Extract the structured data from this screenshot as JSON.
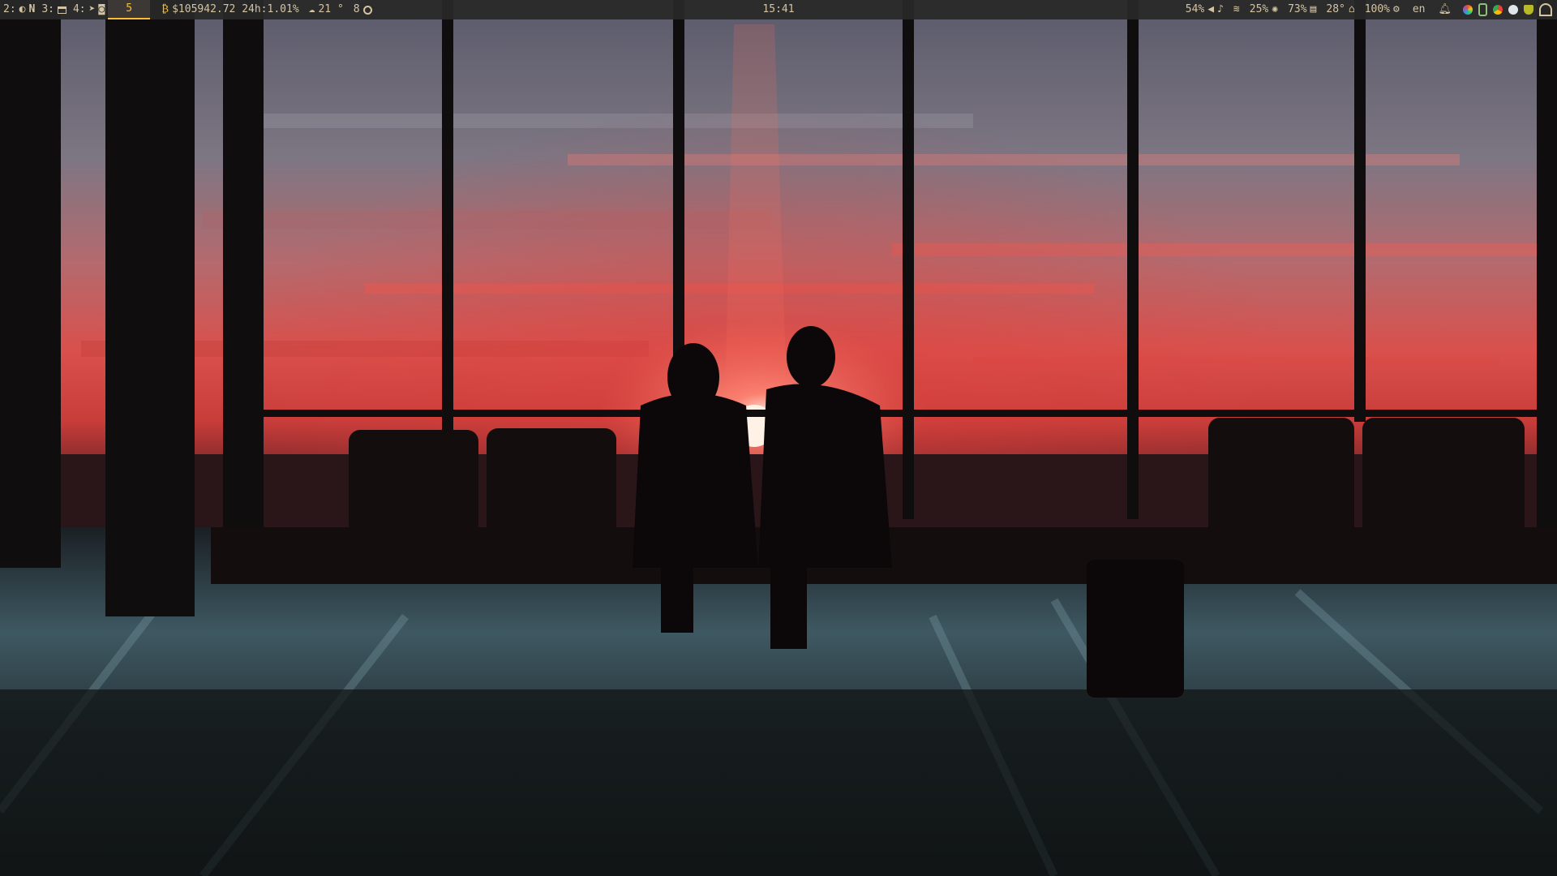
{
  "workspaces": [
    {
      "label": "2:"
    },
    {
      "label": "3:"
    },
    {
      "label": "4:"
    },
    {
      "label": "5",
      "active": true
    }
  ],
  "crypto": {
    "symbol": "₿",
    "text": "$105942.72 24h:1.01%"
  },
  "weather": {
    "temp": "21 °"
  },
  "updates": {
    "count": "8"
  },
  "clock": "15:41",
  "status": {
    "brightness": "54%",
    "volume_icon": "speaker-icon",
    "mic_icon": "microphone-icon",
    "wifi_icon": "wifi-icon",
    "cpu": "25%",
    "memory": "73%",
    "temperature": "28°",
    "battery": "100%",
    "keyboard_layout": "en"
  },
  "colors": {
    "bar_bg": "#282828",
    "bar_fg": "#ebdbb2",
    "accent": "#fabd2f"
  }
}
